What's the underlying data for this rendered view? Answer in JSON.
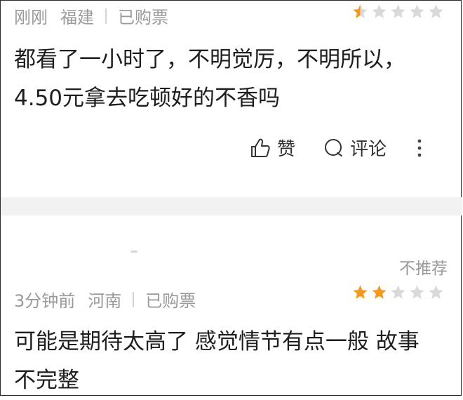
{
  "comments": [
    {
      "time": "刚刚",
      "location": "福建",
      "purchase_status": "已购票",
      "rating": 0.5,
      "text_lines": [
        "都看了一小时了，不明觉厉，不明所以，",
        "4.50元拿去吃顿好的不香吗"
      ],
      "like_label": "赞",
      "comment_label": "评论",
      "more_icon": "more-vertical-icon"
    },
    {
      "time": "3分钟前",
      "location": "河南",
      "purchase_status": "已购票",
      "rating": 2,
      "not_recommend_label": "不推荐",
      "text_lines": [
        "可能是期待太高了 感觉情节有点一般 故事",
        "不完整"
      ]
    }
  ],
  "colors": {
    "star_active": "#f29a1f",
    "star_inactive": "#d9d9d9",
    "meta_text": "#9a9a9a",
    "divider_band": "#f2f2f2"
  }
}
